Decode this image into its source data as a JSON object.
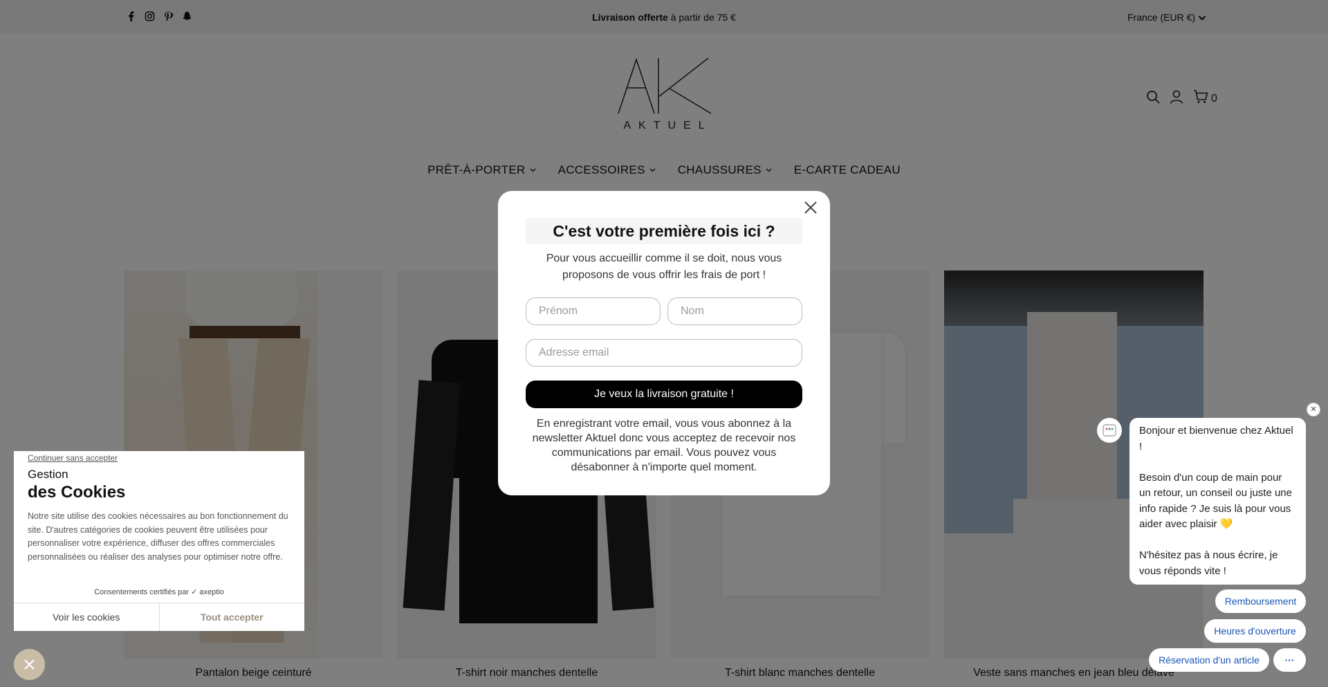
{
  "announcement": {
    "bold": "Livraison offerte",
    "rest": " à partir de 75 €"
  },
  "country_selector": "France (EUR €)",
  "social_icons": [
    "facebook-icon",
    "instagram-icon",
    "pinterest-icon",
    "snapchat-icon"
  ],
  "logo": {
    "letters": "AK",
    "word": "AKTUEL"
  },
  "header": {
    "cart_count": "0"
  },
  "nav": [
    {
      "label": "PRÊT-À-PORTER",
      "has_dropdown": true
    },
    {
      "label": "ACCESSOIRES",
      "has_dropdown": true
    },
    {
      "label": "CHAUSSURES",
      "has_dropdown": true
    },
    {
      "label": "E-CARTE CADEAU",
      "has_dropdown": false
    }
  ],
  "products": [
    {
      "title": "Pantalon beige ceinturé"
    },
    {
      "title": "T-shirt noir manches dentelle"
    },
    {
      "title": "T-shirt blanc manches dentelle"
    },
    {
      "title": "Veste sans manches en jean bleu délavé"
    }
  ],
  "modal": {
    "title": "C'est votre première fois ici ?",
    "subtitle": "Pour vous accueillir comme il se doit, nous vous proposons de vous offrir les frais de port !",
    "first_name_placeholder": "Prénom",
    "last_name_placeholder": "Nom",
    "email_placeholder": "Adresse email",
    "submit_label": "Je veux la livraison gratuite !",
    "legal": "En enregistrant votre email, vous vous abonnez à la newsletter Aktuel donc vous acceptez de recevoir nos communications par email. Vous pouvez vous désabonner à n'importe quel moment."
  },
  "cookie": {
    "continue_label": "Continuer sans accepter",
    "heading_small": "Gestion",
    "heading_large": "des Cookies",
    "body": "Notre site utilise des cookies nécessaires au bon fonctionnement du site. D'autres catégories de cookies peuvent être utilisées pour personnaliser votre expérience, diffuser des offres commerciales personnalisées ou réaliser des analyses pour optimiser notre offre.",
    "certified": "Consentements certifiés par",
    "certified_brand": "axeptio",
    "view_label": "Voir les cookies",
    "accept_label": "Tout accepter"
  },
  "chat": {
    "line1": "Bonjour et bienvenue chez Aktuel !",
    "line2": "Besoin d'un coup de main pour un retour, un conseil ou juste une info rapide ? Je suis là pour vous aider avec plaisir 💛",
    "line3": "N'hésitez pas à nous écrire, je vous réponds vite !",
    "chip_refund": "Remboursement",
    "chip_hours": "Heures d'ouverture",
    "chip_reservation": "Réservation d'un article",
    "chip_more": "···"
  },
  "colors": {
    "accent_cookie": "#c9bda5",
    "chat_chip_text": "#1a55b5",
    "button_dark": "#000000",
    "overlay": "rgba(0,0,0,0.5)"
  }
}
